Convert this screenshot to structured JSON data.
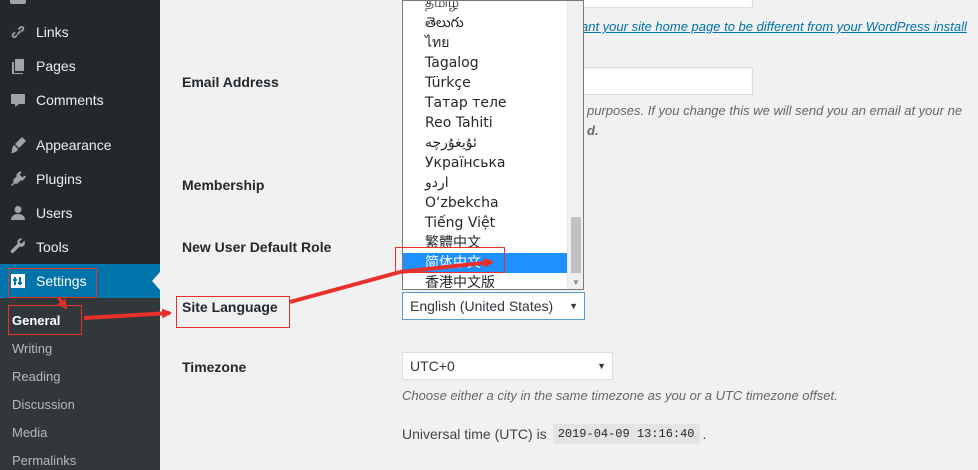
{
  "sidebar": {
    "menu": [
      {
        "key": "links",
        "label": "Links",
        "icon": "link-icon"
      },
      {
        "key": "pages",
        "label": "Pages",
        "icon": "pages-icon"
      },
      {
        "key": "comments",
        "label": "Comments",
        "icon": "comments-icon"
      },
      {
        "key": "appearance",
        "label": "Appearance",
        "icon": "appearance-brush-icon"
      },
      {
        "key": "plugins",
        "label": "Plugins",
        "icon": "plugins-icon"
      },
      {
        "key": "users",
        "label": "Users",
        "icon": "users-icon"
      },
      {
        "key": "tools",
        "label": "Tools",
        "icon": "tools-wrench-icon"
      },
      {
        "key": "settings",
        "label": "Settings",
        "icon": "settings-sliders-icon",
        "current": true
      }
    ],
    "submenu": [
      {
        "key": "general",
        "label": "General",
        "active": true
      },
      {
        "key": "writing",
        "label": "Writing"
      },
      {
        "key": "reading",
        "label": "Reading"
      },
      {
        "key": "discussion",
        "label": "Discussion"
      },
      {
        "key": "media",
        "label": "Media"
      },
      {
        "key": "permalinks",
        "label": "Permalinks"
      }
    ]
  },
  "form": {
    "site_address_desc_link": "ant your site home page to be different from your WordPress install",
    "email_label": "Email Address",
    "email_value": "",
    "email_desc_line1": "purposes. If you change this we will send you an email at your ne",
    "email_desc_line2": "d.",
    "membership_label": "Membership",
    "default_role_label": "New User Default Role",
    "site_language_label": "Site Language",
    "site_language_value": "English (United States)",
    "timezone_label": "Timezone",
    "timezone_value": "UTC+0",
    "timezone_desc": "Choose either a city in the same timezone as you or a UTC timezone offset.",
    "utc_prefix": "Universal time (UTC) is",
    "utc_time": "2019-04-09 13:16:40",
    "utc_suffix": "."
  },
  "language_dropdown": {
    "options": [
      "தமிழ்",
      "తెలుగు",
      "ไทย",
      "Tagalog",
      "Türkçe",
      "Татар теле",
      "Reo Tahiti",
      "ئۇيغۇرچە",
      "Українська",
      "اردو",
      "O‘zbekcha",
      "Tiếng Việt",
      "繁體中文",
      "简体中文",
      "香港中文版"
    ],
    "highlighted": "简体中文"
  },
  "colors": {
    "sidebar_bg": "#23282d",
    "submenu_bg": "#32373c",
    "accent": "#0073aa",
    "dropdown_highlight": "#1e90ff",
    "annotation_red": "#e8302a"
  }
}
